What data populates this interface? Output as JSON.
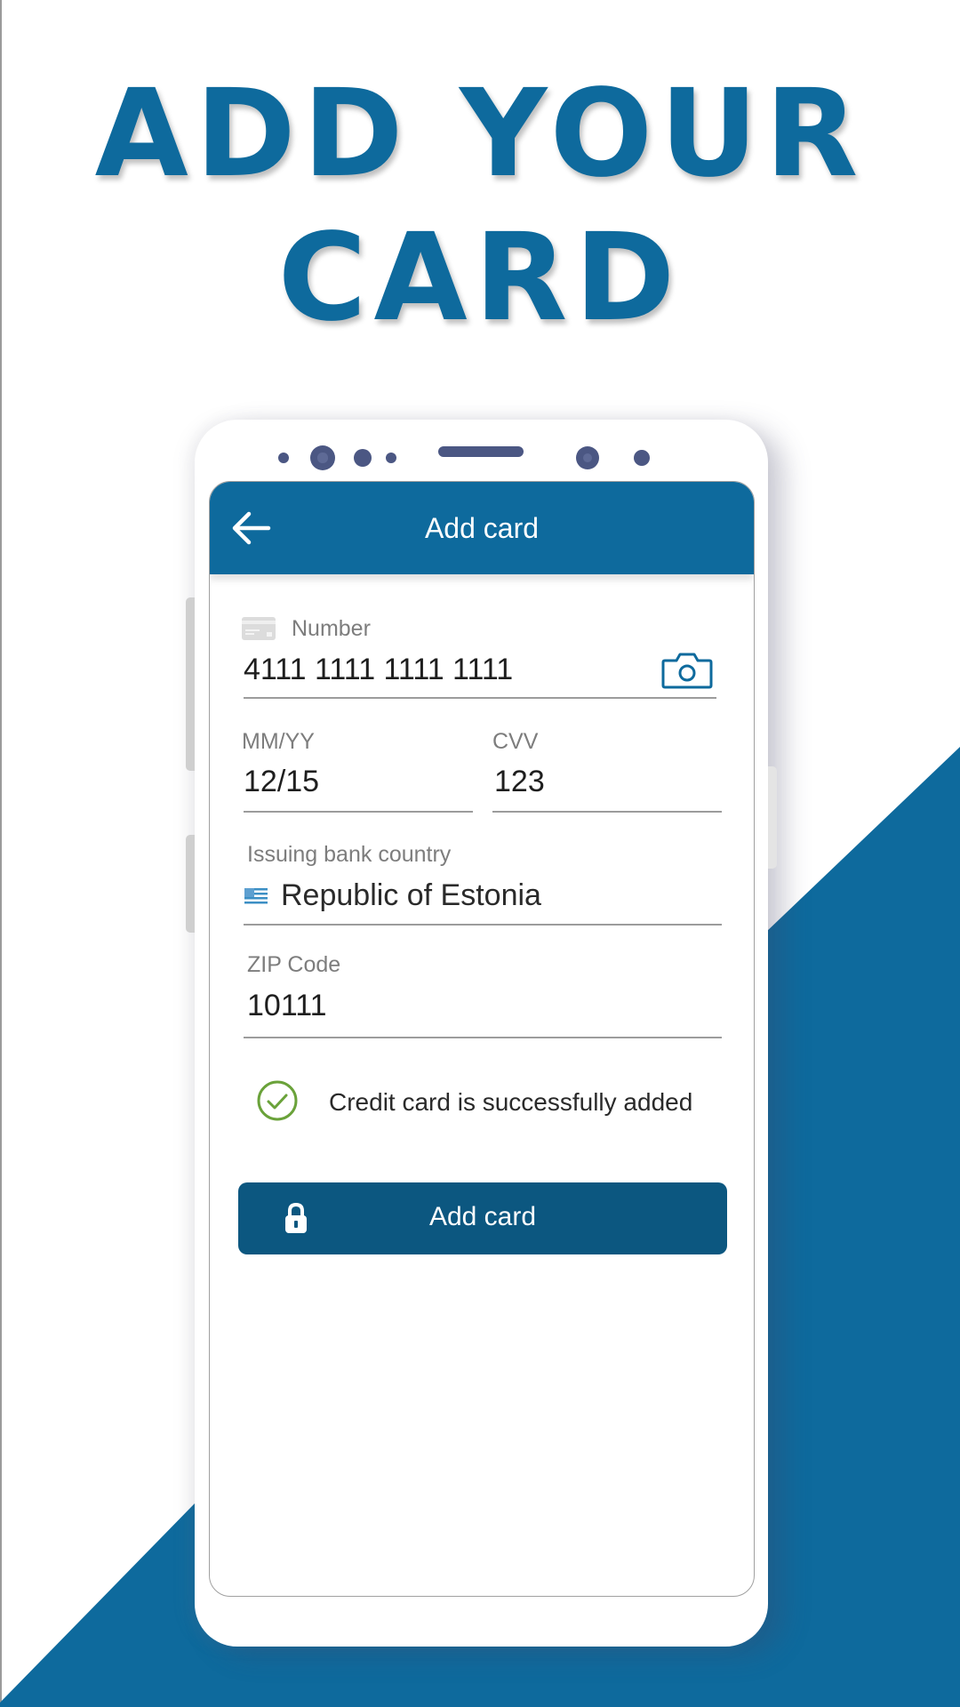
{
  "headline": {
    "line1": "ADD YOUR",
    "line2": "CARD"
  },
  "colors": {
    "brand": "#0e6a9d",
    "button": "#0c5780",
    "success": "#6aa23a",
    "label": "#7d7d7d"
  },
  "appbar": {
    "title": "Add card",
    "back_icon": "arrow-left-icon"
  },
  "form": {
    "number": {
      "label": "Number",
      "value": "4111 1111 1111 1111",
      "icon": "credit-card-icon",
      "action_icon": "camera-icon"
    },
    "expiry": {
      "label": "MM/YY",
      "value": "12/15"
    },
    "cvv": {
      "label": "CVV",
      "value": "123"
    },
    "country": {
      "label": "Issuing bank country",
      "value": "Republic of Estonia",
      "icon": "flag-icon"
    },
    "zip": {
      "label": "ZIP Code",
      "value": "10111"
    }
  },
  "status": {
    "message": "Credit card is successfully added",
    "icon": "check-circle-icon"
  },
  "submit": {
    "label": "Add card",
    "icon": "lock-icon"
  }
}
